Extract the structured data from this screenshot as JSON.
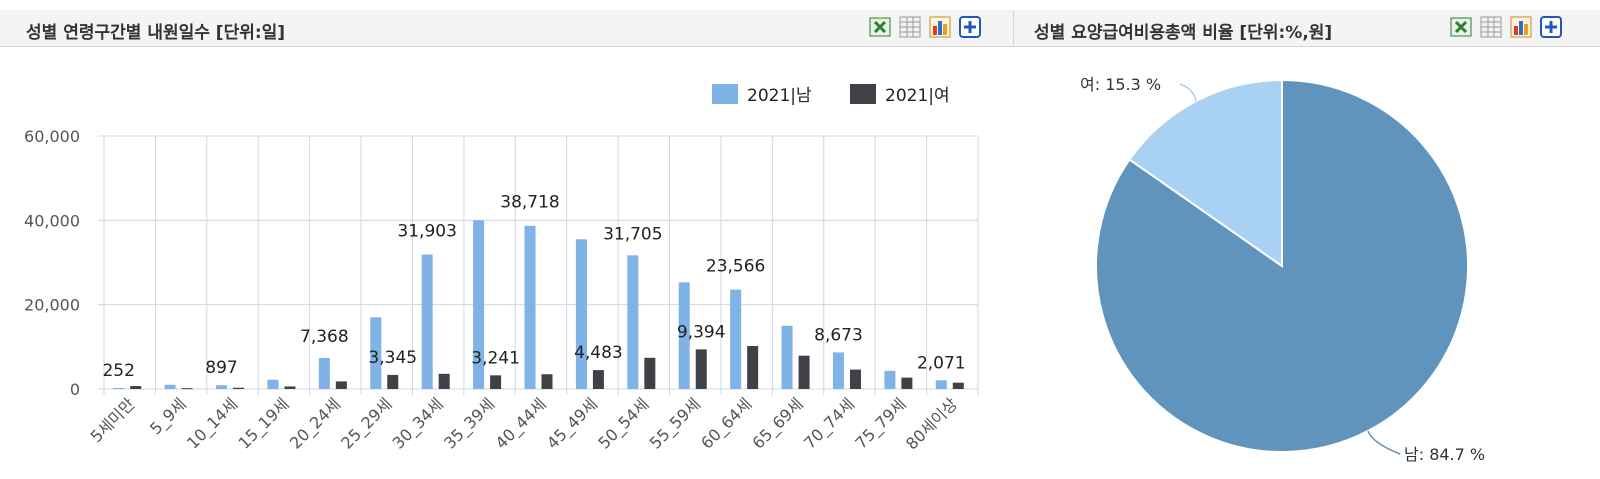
{
  "left_panel": {
    "title": "성별 연령구간별 내원일수 [단위:일]"
  },
  "right_panel": {
    "title": "성별 요양급여비용총액 비율 [단위:%,원]"
  },
  "toolbar_icons": [
    "excel-export-icon",
    "table-view-icon",
    "bar-chart-icon",
    "expand-plus-icon"
  ],
  "colors": {
    "male": "#7fb2e5",
    "female": "#404047",
    "pie_male": "#6094bd",
    "pie_female": "#a8d1f3",
    "grid": "#cdd8e6"
  },
  "chart_data": [
    {
      "type": "bar",
      "categories": [
        "5세미만",
        "5_9세",
        "10_14세",
        "15_19세",
        "20_24세",
        "25_29세",
        "30_34세",
        "35_39세",
        "40_44세",
        "45_49세",
        "50_54세",
        "55_59세",
        "60_64세",
        "65_69세",
        "70_74세",
        "75_79세",
        "80세이상"
      ],
      "series": [
        {
          "name": "2021|남",
          "values": [
            252,
            1000,
            897,
            2200,
            7368,
            17000,
            31903,
            40000,
            38718,
            35500,
            31705,
            25300,
            23566,
            15000,
            8673,
            4300,
            2071
          ]
        },
        {
          "name": "2021|여",
          "values": [
            700,
            200,
            300,
            600,
            1800,
            3345,
            3600,
            3241,
            3500,
            4483,
            7400,
            9394,
            10200,
            7900,
            4600,
            2700,
            1500
          ]
        }
      ],
      "data_labels": [
        {
          "category": "5세미만",
          "text": "252"
        },
        {
          "category": "10_14세",
          "text": "897"
        },
        {
          "category": "20_24세",
          "text": "7,368"
        },
        {
          "category": "25_29세",
          "text": "3,345"
        },
        {
          "category": "30_34세",
          "text": "31,903"
        },
        {
          "category": "35_39세",
          "text": "3,241"
        },
        {
          "category": "40_44세",
          "text": "38,718"
        },
        {
          "category": "45_49세",
          "text": "4,483"
        },
        {
          "category": "50_54세",
          "text": "31,705"
        },
        {
          "category": "55_59세",
          "text": "9,394"
        },
        {
          "category": "60_64세",
          "text": "23,566"
        },
        {
          "category": "70_74세",
          "text": "8,673"
        },
        {
          "category": "80세이상",
          "text": "2,071"
        }
      ],
      "yticks": [
        "0",
        "20,000",
        "40,000",
        "60,000"
      ],
      "ylim": [
        0,
        60000
      ],
      "legend_position": "top-right",
      "grid": true
    },
    {
      "type": "pie",
      "slices": [
        {
          "name": "남",
          "value": 84.7,
          "label": "남: 84.7 %"
        },
        {
          "name": "여",
          "value": 15.3,
          "label": "여: 15.3 %"
        }
      ]
    }
  ]
}
